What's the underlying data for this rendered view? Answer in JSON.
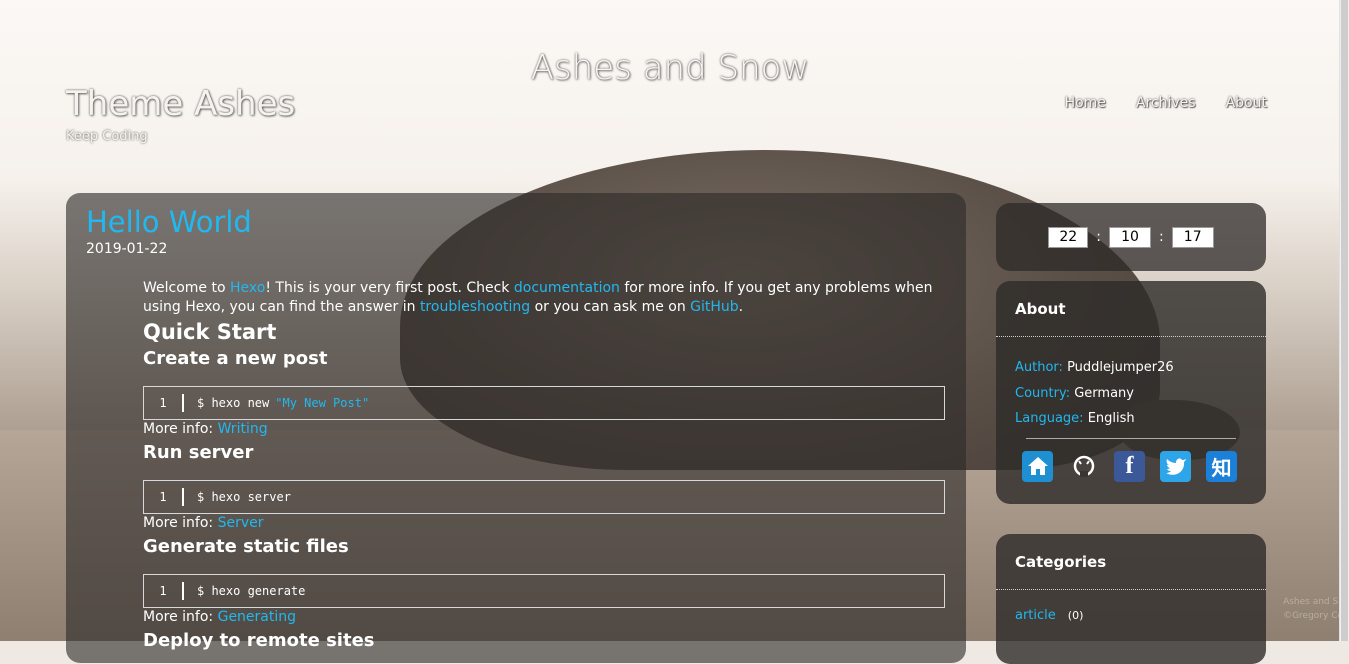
{
  "header": {
    "brand": "Ashes and Snow",
    "site_title": "Theme Ashes",
    "site_subtitle": "Keep Coding",
    "nav": [
      "Home",
      "Archives",
      "About"
    ]
  },
  "post": {
    "title": "Hello World",
    "date": "2019-01-22",
    "intro": {
      "t1": "Welcome to ",
      "l1": "Hexo",
      "t2": "! This is your very first post. Check ",
      "l2": "documentation",
      "t3": " for more info. If you get any problems when using Hexo, you can find the answer in ",
      "l3": "troubleshooting",
      "t4": " or you can ask me on ",
      "l4": "GitHub",
      "t5": "."
    },
    "quick_start": "Quick Start",
    "sections": [
      {
        "heading": "Create a new post",
        "line_no": "1",
        "code": "$ hexo new",
        "code_str": "\"My New Post\"",
        "more_label": "More info: ",
        "more_link": "Writing"
      },
      {
        "heading": "Run server",
        "line_no": "1",
        "code": "$ hexo server",
        "code_str": "",
        "more_label": "More info: ",
        "more_link": "Server"
      },
      {
        "heading": "Generate static files",
        "line_no": "1",
        "code": "$ hexo generate",
        "code_str": "",
        "more_label": "More info: ",
        "more_link": "Generating"
      }
    ],
    "next_heading": "Deploy to remote sites"
  },
  "clock": {
    "hours": "22",
    "minutes": "10",
    "seconds": "17",
    "sep": ":"
  },
  "about": {
    "title": "About",
    "author_label": "Author:",
    "author": "Puddlejumper26",
    "country_label": "Country:",
    "country": "Germany",
    "language_label": "Language:",
    "language": "English",
    "socials": [
      "home-icon",
      "github-icon",
      "facebook-icon",
      "twitter-icon",
      "zhihu-icon"
    ],
    "facebook_glyph": "f",
    "zhihu_glyph": "知"
  },
  "categories": {
    "title": "Categories",
    "items": [
      {
        "name": "article",
        "count": "(0)"
      }
    ]
  },
  "photo_credit": {
    "line1": "Ashes and S",
    "line2": "©Gregory Co"
  },
  "colors": {
    "accent": "#21b8f0",
    "panel": "#2d2a28"
  }
}
